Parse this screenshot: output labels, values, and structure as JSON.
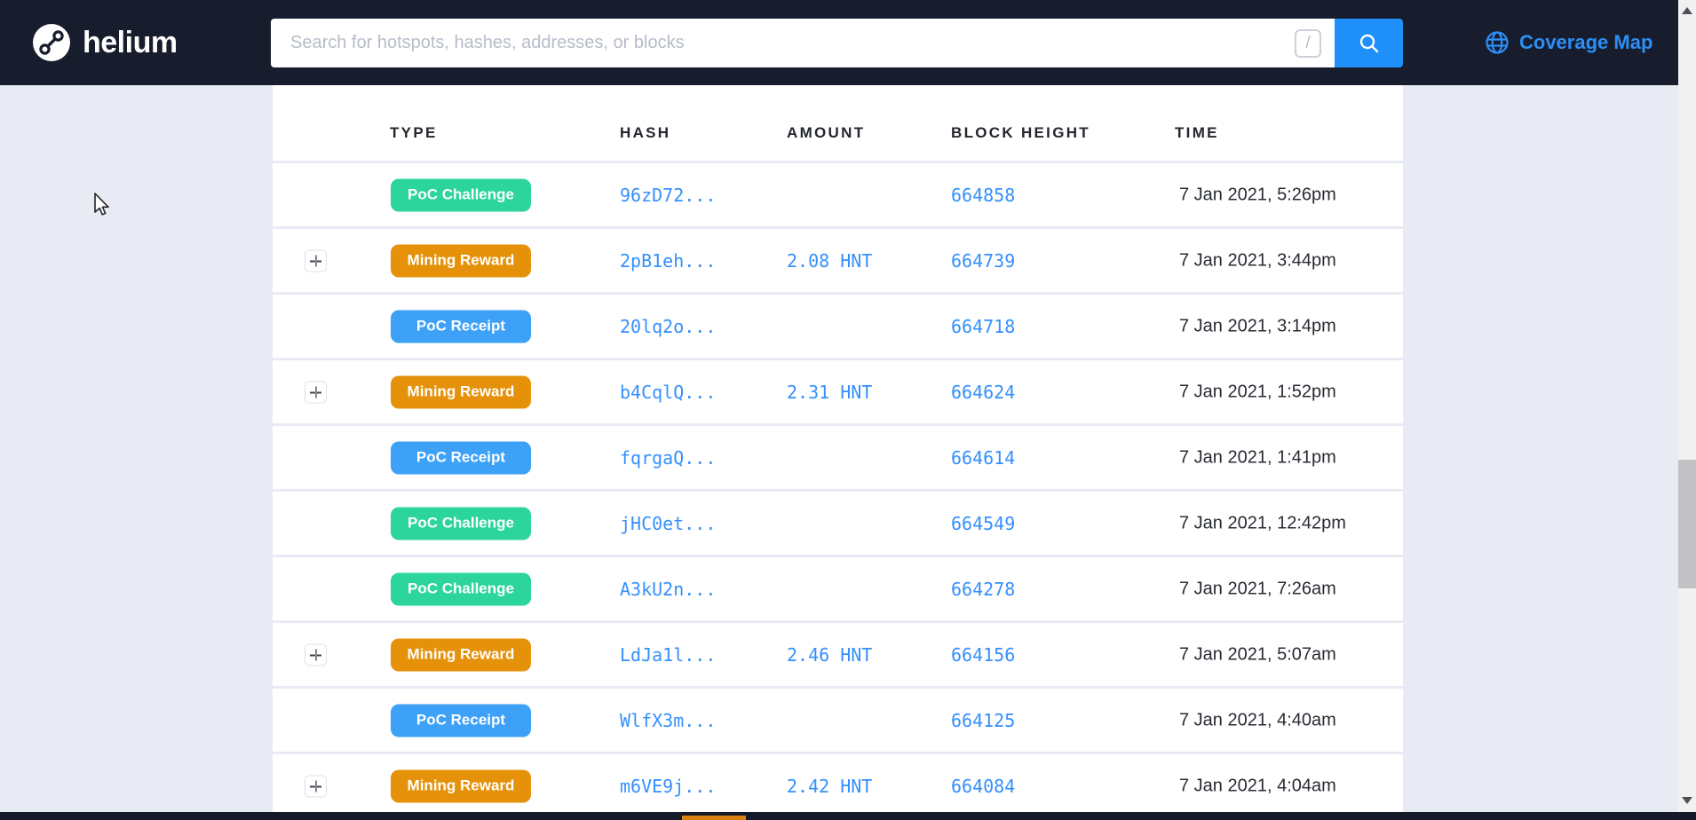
{
  "navbar": {
    "brand": "helium",
    "search": {
      "placeholder": "Search for hotspots, hashes, addresses, or blocks",
      "shortcut_hint": "/"
    },
    "coverage_map_label": "Coverage Map"
  },
  "table": {
    "headers": [
      "TYPE",
      "HASH",
      "AMOUNT",
      "BLOCK HEIGHT",
      "TIME"
    ],
    "badge_colors": {
      "PoC Challenge": "#2bd59c",
      "Mining Reward": "#e5920a",
      "PoC Receipt": "#3ea1f8"
    },
    "rows": [
      {
        "expandable": false,
        "type": "PoC Challenge",
        "hash": "96zD72...",
        "amount": "",
        "block": "664858",
        "time": "7 Jan 2021, 5:26pm"
      },
      {
        "expandable": true,
        "type": "Mining Reward",
        "hash": "2pB1eh...",
        "amount": "2.08 HNT",
        "block": "664739",
        "time": "7 Jan 2021, 3:44pm"
      },
      {
        "expandable": false,
        "type": "PoC Receipt",
        "hash": "20lq2o...",
        "amount": "",
        "block": "664718",
        "time": "7 Jan 2021, 3:14pm"
      },
      {
        "expandable": true,
        "type": "Mining Reward",
        "hash": "b4CqlQ...",
        "amount": "2.31 HNT",
        "block": "664624",
        "time": "7 Jan 2021, 1:52pm"
      },
      {
        "expandable": false,
        "type": "PoC Receipt",
        "hash": "fqrgaQ...",
        "amount": "",
        "block": "664614",
        "time": "7 Jan 2021, 1:41pm"
      },
      {
        "expandable": false,
        "type": "PoC Challenge",
        "hash": "jHC0et...",
        "amount": "",
        "block": "664549",
        "time": "7 Jan 2021, 12:42pm"
      },
      {
        "expandable": false,
        "type": "PoC Challenge",
        "hash": "A3kU2n...",
        "amount": "",
        "block": "664278",
        "time": "7 Jan 2021, 7:26am"
      },
      {
        "expandable": true,
        "type": "Mining Reward",
        "hash": "LdJa1l...",
        "amount": "2.46 HNT",
        "block": "664156",
        "time": "7 Jan 2021, 5:07am"
      },
      {
        "expandable": false,
        "type": "PoC Receipt",
        "hash": "WlfX3m...",
        "amount": "",
        "block": "664125",
        "time": "7 Jan 2021, 4:40am"
      },
      {
        "expandable": true,
        "type": "Mining Reward",
        "hash": "m6VE9j...",
        "amount": "2.42 HNT",
        "block": "664084",
        "time": "7 Jan 2021, 4:04am"
      }
    ]
  },
  "colors": {
    "navbar_bg": "#171d2c",
    "accent_blue": "#3590fc",
    "search_button_blue": "#1f90fa",
    "coverage_link_blue": "#2d8ef8",
    "page_bg": "#e9ebf4",
    "footer_bar": "#141a28",
    "footer_accent_orange": "#d9820f"
  },
  "icons": {
    "brand": "helium-logo",
    "search": "magnifier",
    "coverage": "globe",
    "expand": "plus",
    "scroll_up": "triangle-up",
    "scroll_down": "triangle-down",
    "cursor": "arrow-pointer"
  }
}
